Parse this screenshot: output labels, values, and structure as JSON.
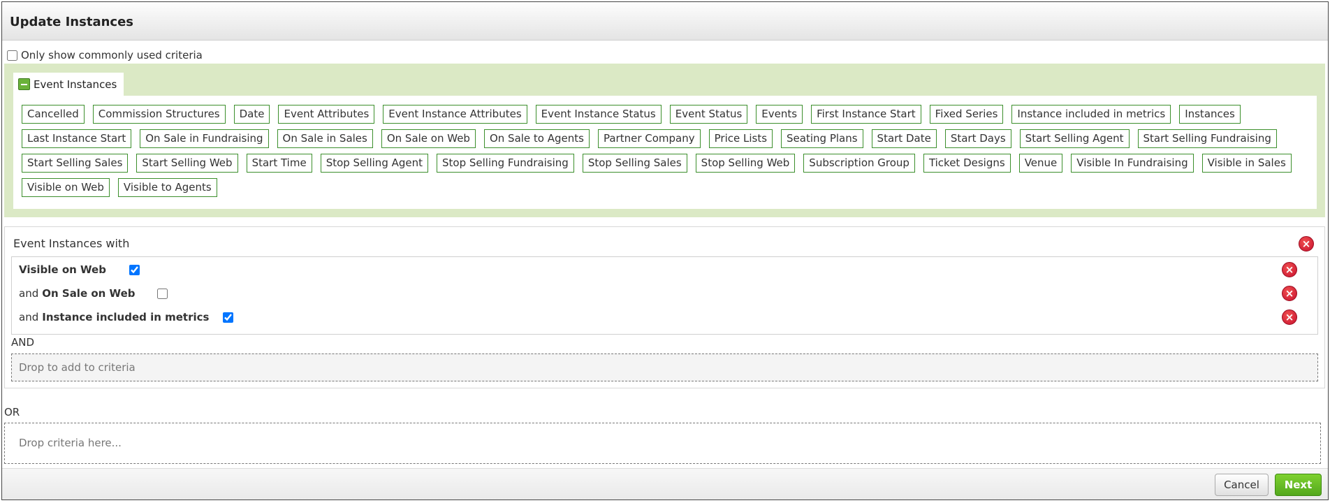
{
  "dialog": {
    "title": "Update Instances"
  },
  "filter": {
    "common_only_label": "Only show commonly used criteria",
    "common_only_checked": false
  },
  "category": {
    "tab_label": "Event Instances",
    "tags": [
      "Cancelled",
      "Commission Structures",
      "Date",
      "Event Attributes",
      "Event Instance Attributes",
      "Event Instance Status",
      "Event Status",
      "Events",
      "First Instance Start",
      "Fixed Series",
      "Instance included in metrics",
      "Instances",
      "Last Instance Start",
      "On Sale in Fundraising",
      "On Sale in Sales",
      "On Sale on Web",
      "On Sale to Agents",
      "Partner Company",
      "Price Lists",
      "Seating Plans",
      "Start Date",
      "Start Days",
      "Start Selling Agent",
      "Start Selling Fundraising",
      "Start Selling Sales",
      "Start Selling Web",
      "Start Time",
      "Stop Selling Agent",
      "Stop Selling Fundraising",
      "Stop Selling Sales",
      "Stop Selling Web",
      "Subscription Group",
      "Ticket Designs",
      "Venue",
      "Visible In Fundraising",
      "Visible in Sales",
      "Visible on Web",
      "Visible to Agents"
    ]
  },
  "criteria": {
    "group_title": "Event Instances with",
    "rows": [
      {
        "prefix": "",
        "field": "Visible on Web",
        "checked": true
      },
      {
        "prefix": "and",
        "field": "On Sale on Web",
        "checked": false
      },
      {
        "prefix": "and",
        "field": "Instance included in metrics",
        "checked": true
      }
    ],
    "and_label": "AND",
    "drop_inner_label": "Drop to add to criteria",
    "or_label": "OR",
    "drop_outer_label": "Drop criteria here...",
    "remove_icon": "remove-circle-icon"
  },
  "footer": {
    "cancel_label": "Cancel",
    "next_label": "Next"
  },
  "colors": {
    "accent_green": "#6ab23a",
    "tag_border": "#3c8f2c",
    "section_bg": "#dbe9c5",
    "remove_red": "#c8102e"
  }
}
